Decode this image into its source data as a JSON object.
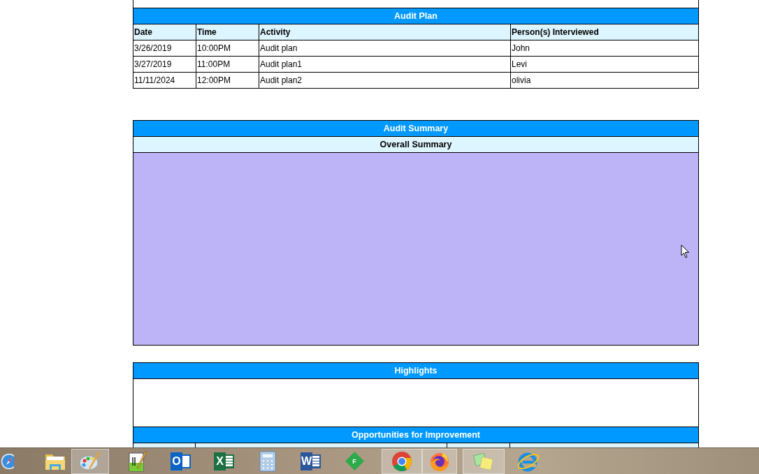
{
  "audit_plan": {
    "title": "Audit Plan",
    "columns": [
      "Date",
      "Time",
      "Activity",
      "Person(s) Interviewed"
    ],
    "rows": [
      [
        "3/26/2019",
        "10:00PM",
        "Audit plan",
        "John"
      ],
      [
        "3/27/2019",
        "11:00PM",
        "Audit plan1",
        "Levi"
      ],
      [
        "11/11/2024",
        "12:00PM",
        "Audit plan2",
        "olivia"
      ]
    ]
  },
  "audit_summary": {
    "title": "Audit Summary",
    "subtitle": "Overall Summary"
  },
  "highlights": {
    "title": "Highlights"
  },
  "opportunities": {
    "title": "Opportunities for Improvement"
  },
  "taskbar": {
    "items": [
      {
        "kind": "compass",
        "running": false
      },
      {
        "kind": "folder",
        "running": false
      },
      {
        "kind": "palette",
        "running": true
      },
      {
        "kind": "notepad",
        "running": false
      },
      {
        "kind": "mail",
        "letter": "O",
        "running": false
      },
      {
        "kind": "sheet",
        "letter": "X",
        "running": false
      },
      {
        "kind": "calculator",
        "running": false
      },
      {
        "kind": "doc",
        "letter": "W",
        "running": false
      },
      {
        "kind": "diamond",
        "letter": "F",
        "running": false
      },
      {
        "kind": "chrome",
        "running": true
      },
      {
        "kind": "firefox",
        "running": true
      },
      {
        "kind": "notes",
        "running": true
      },
      {
        "kind": "ie",
        "running": false
      }
    ]
  }
}
